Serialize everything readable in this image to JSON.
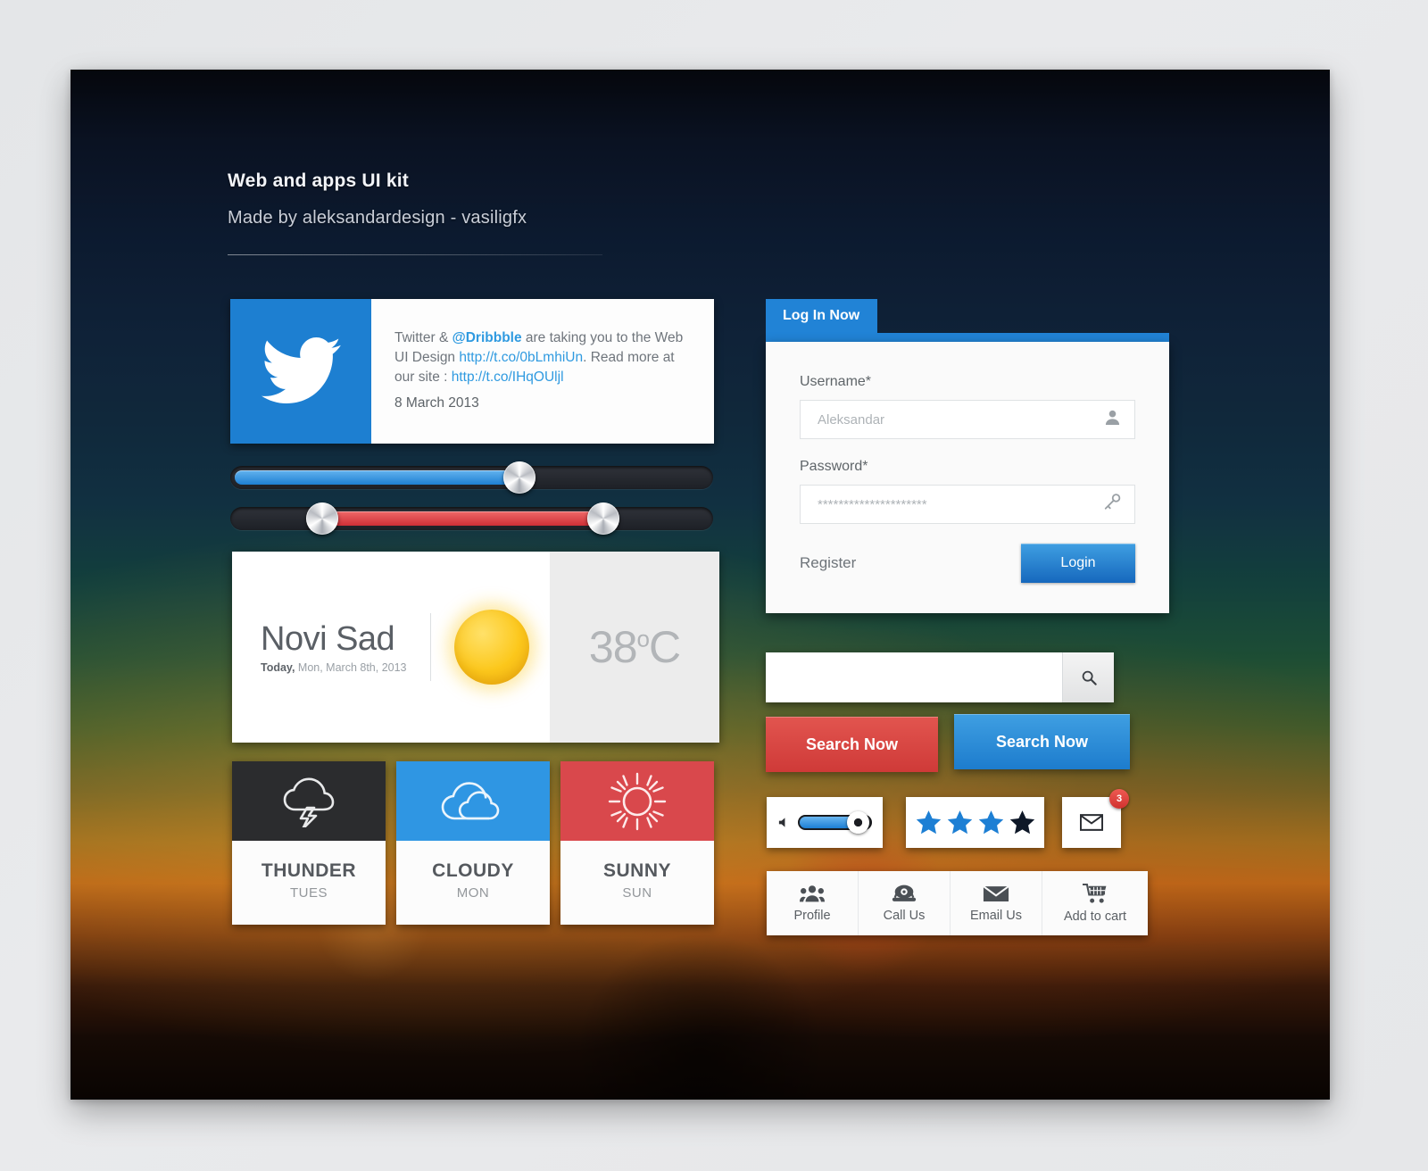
{
  "header": {
    "title": "Web and apps UI kit",
    "subtitle": "Made by aleksandardesign - vasiligfx"
  },
  "twitter_card": {
    "icon": "twitter-bird-icon",
    "text_part1": "Twitter & ",
    "handle": "@Dribbble",
    "text_part2": " are taking you to the Web UI Design ",
    "link1": "http://t.co/0bLmhiUn",
    "text_part3": ". Read more at our site : ",
    "link2": "http://t.co/IHqOUljl",
    "date": "8 March 2013",
    "brand_color": "#1d7fd1"
  },
  "sliders": [
    {
      "name": "blue-slider",
      "type": "single",
      "value": 60,
      "color": "#1e7fd2"
    },
    {
      "name": "red-range-slider",
      "type": "range",
      "start": 19,
      "end": 77,
      "color": "#cf2f36"
    }
  ],
  "weather": {
    "city": "Novi Sad",
    "date_prefix": "Today,",
    "date": " Mon, March 8th, 2013",
    "icon": "sun-icon",
    "temperature": "38",
    "degree": "o",
    "unit": "C"
  },
  "forecast": [
    {
      "name": "THUNDER",
      "day": "TUES",
      "icon": "thunder-cloud-icon",
      "bg": "#2b2c2e"
    },
    {
      "name": "CLOUDY",
      "day": "MON",
      "icon": "cloud-icon",
      "bg": "#2f96e3"
    },
    {
      "name": "SUNNY",
      "day": "SUN",
      "icon": "sun-rays-icon",
      "bg": "#d9484c"
    }
  ],
  "login": {
    "tab_label": "Log In Now",
    "username_label": "Username*",
    "username_value": "Aleksandar",
    "username_icon": "user-icon",
    "password_label": "Password*",
    "password_value": "*********************",
    "password_icon": "key-icon",
    "register_label": "Register",
    "login_button": "Login",
    "accent_color": "#2183d6"
  },
  "search": {
    "placeholder": "",
    "value": "",
    "button_icon": "magnifier-icon",
    "red_button": "Search Now",
    "blue_button": "Search Now",
    "red_color": "#cf3a38",
    "blue_color": "#1d7ccd"
  },
  "volume": {
    "icon": "speaker-icon",
    "value": 68
  },
  "rating": {
    "filled": 3,
    "total": 4,
    "filled_color": "#1d7fd4",
    "last_color": "#0e1828"
  },
  "mail": {
    "icon": "envelope-icon",
    "badge_count": "3"
  },
  "actions": [
    {
      "label": "Profile",
      "icon": "people-icon"
    },
    {
      "label": "Call Us",
      "icon": "phone-icon"
    },
    {
      "label": "Email Us",
      "icon": "envelope-icon"
    },
    {
      "label": "Add to cart",
      "icon": "cart-icon"
    }
  ]
}
